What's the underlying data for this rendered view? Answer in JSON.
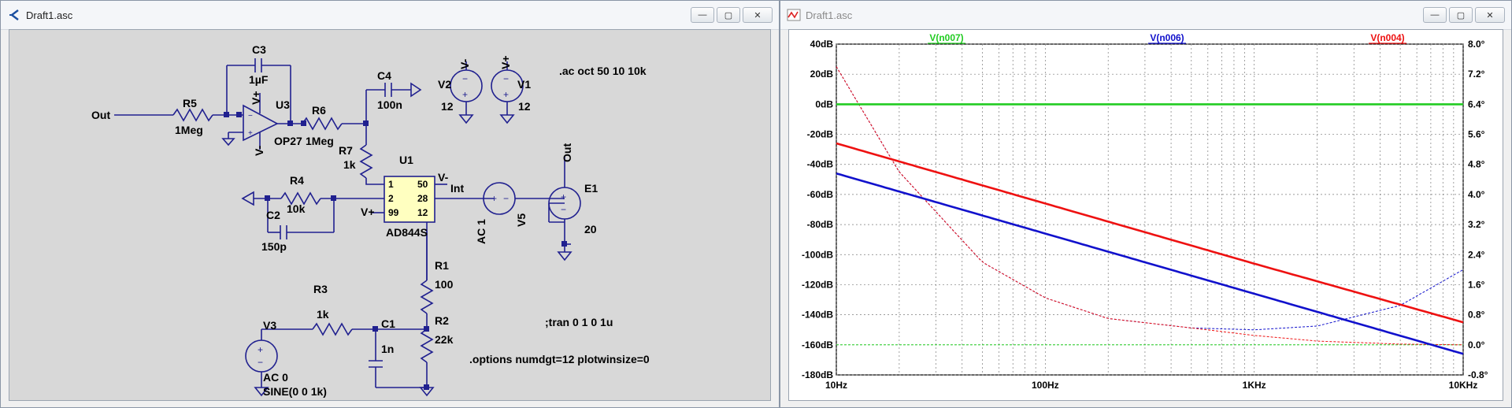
{
  "schematic_window": {
    "title": "Draft1.asc",
    "controls": {
      "minimize": "—",
      "maximize": "▢",
      "close": "✕"
    },
    "labels": {
      "out_left": "Out",
      "r5": "R5",
      "r5_val": "1Meg",
      "c3": "C3",
      "c3_val": "1µF",
      "u3": "U3",
      "u3_model": "OP27",
      "vplus": "V+",
      "vminus": "V-",
      "r6": "R6",
      "r6_val": "1Meg",
      "c4": "C4",
      "c4_val": "100n",
      "v2": "V2",
      "v2_net": "V-",
      "v2_val": "12",
      "v1": "V1",
      "v1_net": "V+",
      "v1_val": "12",
      "ac_cmd": ".ac oct 50 10 10k",
      "r7": "R7",
      "r7_val": "1k",
      "u1": "U1",
      "u1_model": "AD844S",
      "u1_pins": {
        "p1": "1",
        "p2": "2",
        "p99": "99",
        "p50": "50",
        "p28": "28",
        "p12": "12"
      },
      "u1_vminus": "V-",
      "u1_vplus": "V+",
      "r4": "R4",
      "r4_val": "10k",
      "c2": "C2",
      "c2_val": "150p",
      "int_label": "Int",
      "v5": "V5",
      "v5_ac": "AC 1",
      "out_right": "Out",
      "e1": "E1",
      "e1_val": "20",
      "r1": "R1",
      "r1_val": "100",
      "r3": "R3",
      "r3_val": "1k",
      "c1": "C1",
      "c1_val": "1n",
      "r2": "R2",
      "r2_val": "22k",
      "v3": "V3",
      "v3_ac": "AC 0",
      "v3_sine": "SINE(0 0 1k)",
      "tran_cmd": ";tran 0 1 0 1u",
      "options_cmd": ".options numdgt=12 plotwinsize=0"
    }
  },
  "plot_window": {
    "title": "Draft1.asc",
    "controls": {
      "minimize": "—",
      "maximize": "▢",
      "close": "✕"
    },
    "chart_data": {
      "type": "line",
      "title": "",
      "xlabel": "",
      "ylabel": "",
      "x_scale": "log",
      "x_range": [
        10,
        10000
      ],
      "x_tick_labels": [
        "10Hz",
        "100Hz",
        "1KHz",
        "10KHz"
      ],
      "y_left_range": [
        -180,
        40
      ],
      "y_left_tick_labels": [
        "40dB",
        "20dB",
        "0dB",
        "-20dB",
        "-40dB",
        "-60dB",
        "-80dB",
        "-100dB",
        "-120dB",
        "-140dB",
        "-160dB",
        "-180dB"
      ],
      "y_right_range": [
        -0.8,
        8.0
      ],
      "y_right_tick_labels": [
        "8.0°",
        "7.2°",
        "6.4°",
        "5.6°",
        "4.8°",
        "4.0°",
        "3.2°",
        "2.4°",
        "1.6°",
        "0.8°",
        "0.0°",
        "-0.8°"
      ],
      "grid": true,
      "legend_position": "top",
      "series": [
        {
          "name": "V(n007)",
          "color": "#22cc22",
          "magnitude_db": [
            [
              10,
              0
            ],
            [
              10000,
              0
            ]
          ],
          "phase_deg": [
            [
              10,
              0.0
            ],
            [
              10000,
              0.0
            ]
          ]
        },
        {
          "name": "V(n006)",
          "color": "#1111cc",
          "magnitude_db": [
            [
              10,
              -46
            ],
            [
              100,
              -86
            ],
            [
              1000,
              -126
            ],
            [
              10000,
              -166
            ]
          ],
          "phase_deg": [
            [
              10,
              7.4
            ],
            [
              20,
              4.6
            ],
            [
              50,
              2.2
            ],
            [
              100,
              1.25
            ],
            [
              200,
              0.7
            ],
            [
              500,
              0.45
            ],
            [
              1000,
              0.4
            ],
            [
              2000,
              0.5
            ],
            [
              5000,
              1.05
            ],
            [
              10000,
              2.0
            ]
          ]
        },
        {
          "name": "V(n004)",
          "color": "#ee1111",
          "magnitude_db": [
            [
              10,
              -26
            ],
            [
              100,
              -66
            ],
            [
              1000,
              -106
            ],
            [
              10000,
              -145
            ]
          ],
          "phase_deg": [
            [
              10,
              7.4
            ],
            [
              20,
              4.6
            ],
            [
              50,
              2.2
            ],
            [
              100,
              1.25
            ],
            [
              200,
              0.7
            ],
            [
              500,
              0.45
            ],
            [
              1000,
              0.25
            ],
            [
              2000,
              0.1
            ],
            [
              5000,
              0.02
            ],
            [
              10000,
              0.0
            ]
          ]
        }
      ]
    }
  }
}
